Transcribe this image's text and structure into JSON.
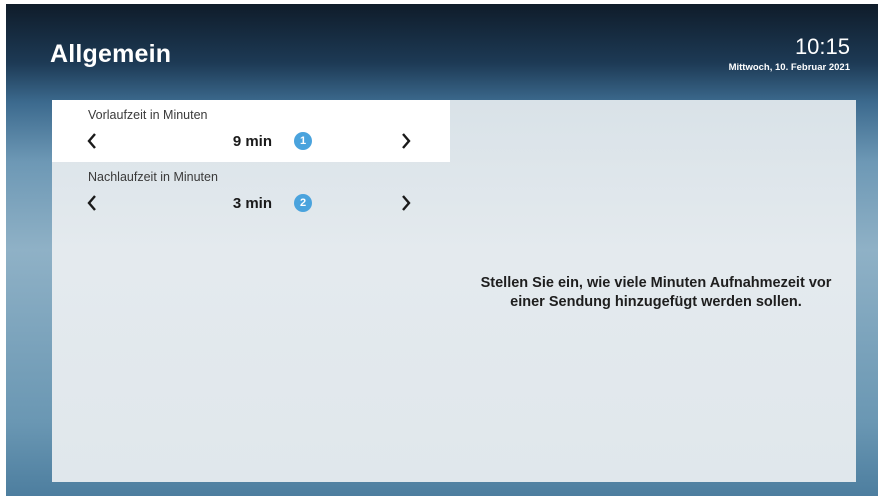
{
  "header": {
    "title": "Allgemein",
    "time": "10:15",
    "date": "Mittwoch, 10. Februar 2021"
  },
  "settings": [
    {
      "label": "Vorlaufzeit in Minuten",
      "value": "9 min",
      "badge": "1",
      "selected": true
    },
    {
      "label": "Nachlaufzeit in Minuten",
      "value": "3 min",
      "badge": "2",
      "selected": false
    }
  ],
  "help": {
    "line1": "Stellen Sie ein, wie viele Minuten Aufnahmezeit vor",
    "line2": "einer Sendung hinzugefügt werden sollen."
  },
  "icons": {
    "left": "chevron-left-icon",
    "right": "chevron-right-icon"
  },
  "colors": {
    "badge": "#4aa3dd",
    "selected_row": "#ffffff"
  }
}
